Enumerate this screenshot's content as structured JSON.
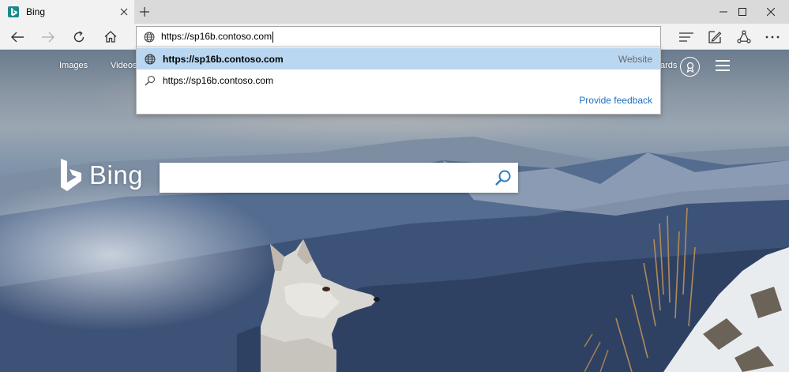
{
  "tab": {
    "title": "Bing",
    "favicon": "bing-favicon"
  },
  "window_controls": [
    "minimize-icon",
    "maximize-icon",
    "close-icon"
  ],
  "address_bar": {
    "value": "https://sp16b.contoso.com"
  },
  "suggestions": [
    {
      "text": "https://sp16b.contoso.com",
      "type": "Website",
      "icon": "globe-icon",
      "selected": true
    },
    {
      "text": "https://sp16b.contoso.com",
      "type": "",
      "icon": "search-icon",
      "selected": false
    }
  ],
  "feedback_label": "Provide feedback",
  "bing_header": {
    "links": [
      "Images",
      "Videos"
    ],
    "rewards_fragment": "ards"
  },
  "brand": {
    "word": "Bing"
  },
  "search": {
    "value": ""
  },
  "colors": {
    "selected_row": "#b9d7f1",
    "link": "#1a6fc4",
    "favicon": "#1a8a8a"
  }
}
